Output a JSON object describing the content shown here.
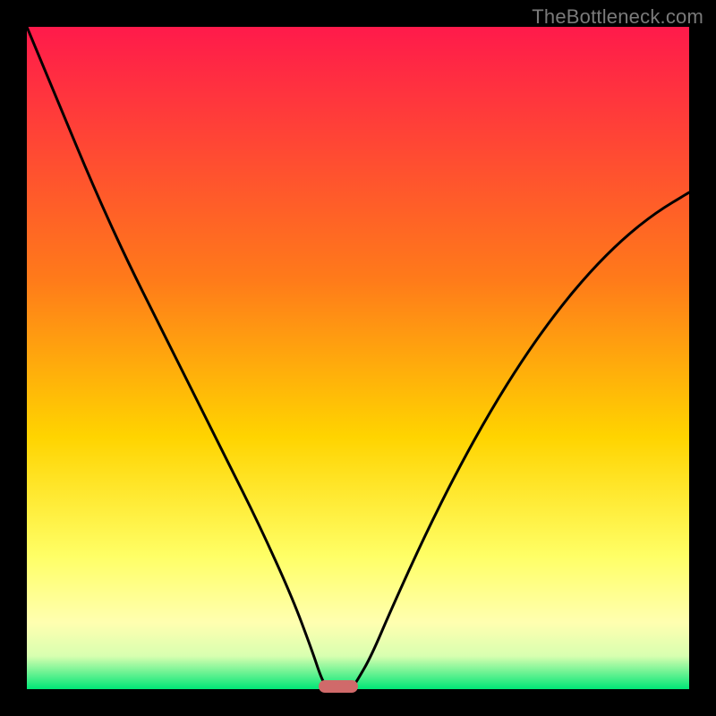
{
  "watermark": "TheBottleneck.com",
  "colors": {
    "top": "#ff1a4b",
    "mid_upper": "#ff7a1a",
    "mid": "#ffd400",
    "mid_lower": "#ffff66",
    "pale": "#ffffb0",
    "near_bottom": "#d8ffb0",
    "bottom": "#00e676",
    "marker": "#d06a6a",
    "curve": "#000000"
  },
  "chart_data": {
    "type": "line",
    "title": "",
    "xlabel": "",
    "ylabel": "",
    "xlim": [
      0,
      100
    ],
    "ylim": [
      0,
      100
    ],
    "series": [
      {
        "name": "left-branch",
        "x": [
          0,
          5,
          10,
          15,
          20,
          25,
          30,
          35,
          40,
          43,
          44.5,
          45.5
        ],
        "values": [
          100,
          88,
          76,
          65,
          55,
          45,
          35,
          25,
          14,
          6,
          1.5,
          0
        ]
      },
      {
        "name": "right-branch",
        "x": [
          49,
          50,
          52,
          55,
          60,
          65,
          70,
          75,
          80,
          85,
          90,
          95,
          100
        ],
        "values": [
          0,
          1.5,
          5,
          12,
          23,
          33,
          42,
          50,
          57,
          63,
          68,
          72,
          75
        ]
      }
    ],
    "marker": {
      "x_center": 47,
      "y": 0,
      "width_pct": 6
    },
    "gradient_stops": [
      {
        "pct": 0,
        "color": "#ff1a4b"
      },
      {
        "pct": 38,
        "color": "#ff7a1a"
      },
      {
        "pct": 62,
        "color": "#ffd400"
      },
      {
        "pct": 80,
        "color": "#ffff66"
      },
      {
        "pct": 90,
        "color": "#ffffb0"
      },
      {
        "pct": 95,
        "color": "#d8ffb0"
      },
      {
        "pct": 100,
        "color": "#00e676"
      }
    ]
  }
}
